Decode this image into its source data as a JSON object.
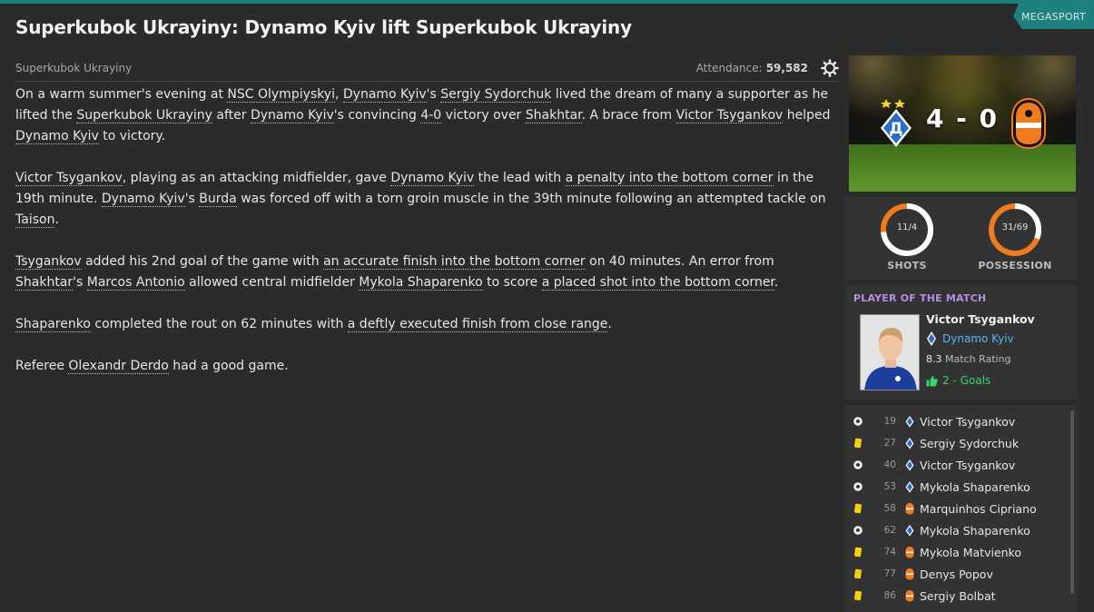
{
  "brand": "MEGASPORT",
  "title": "Superkubok Ukrayiny: Dynamo Kyiv lift Superkubok Ukrayiny",
  "competition": "Superkubok Ukrayiny",
  "attendance_label": "Attendance:",
  "attendance_value": "59,582",
  "article": {
    "p1": [
      {
        "t": "On a warm summer's evening at "
      },
      {
        "t": "NSC Olympiyskyi",
        "link": true
      },
      {
        "t": ", "
      },
      {
        "t": "Dynamo Kyiv",
        "link": true
      },
      {
        "t": "'s "
      },
      {
        "t": "Sergiy Sydorchuk",
        "link": true
      },
      {
        "t": " lived the dream of many a supporter as he lifted the "
      },
      {
        "t": "Superkubok Ukrayiny",
        "link": true
      },
      {
        "t": " after "
      },
      {
        "t": "Dynamo Kyiv",
        "link": true
      },
      {
        "t": "'s convincing "
      },
      {
        "t": "4-0",
        "link": true
      },
      {
        "t": " victory over "
      },
      {
        "t": "Shakhtar",
        "link": true
      },
      {
        "t": ". A brace from "
      },
      {
        "t": "Victor Tsygankov",
        "link": true
      },
      {
        "t": " helped "
      },
      {
        "t": "Dynamo Kyiv",
        "link": true
      },
      {
        "t": " to victory."
      }
    ],
    "p2": [
      {
        "t": "Victor Tsygankov",
        "link": true
      },
      {
        "t": ", playing as an attacking midfielder, gave "
      },
      {
        "t": "Dynamo Kyiv",
        "link": true
      },
      {
        "t": " the lead with "
      },
      {
        "t": "a penalty into the bottom corner",
        "link": true
      },
      {
        "t": " in the 19th minute. "
      },
      {
        "t": "Dynamo Kyiv",
        "link": true
      },
      {
        "t": "'s "
      },
      {
        "t": "Burda",
        "link": true
      },
      {
        "t": " was forced off with a torn groin muscle in the 39th minute following an attempted tackle on "
      },
      {
        "t": "Taison",
        "link": true
      },
      {
        "t": "."
      }
    ],
    "p3": [
      {
        "t": "Tsygankov",
        "link": true
      },
      {
        "t": " added his 2nd goal of the game with "
      },
      {
        "t": "an accurate finish into the bottom corner",
        "link": true
      },
      {
        "t": " on 40 minutes. An error from "
      },
      {
        "t": "Shakhtar",
        "link": true
      },
      {
        "t": "'s "
      },
      {
        "t": "Marcos Antonio",
        "link": true
      },
      {
        "t": " allowed central midfielder "
      },
      {
        "t": "Mykola Shaparenko",
        "link": true
      },
      {
        "t": " to score "
      },
      {
        "t": "a placed shot into the bottom corner",
        "link": true
      },
      {
        "t": "."
      }
    ],
    "p4": [
      {
        "t": "Shaparenko",
        "link": true
      },
      {
        "t": " completed the rout on 62 minutes with "
      },
      {
        "t": "a deftly executed finish from close range",
        "link": true
      },
      {
        "t": "."
      }
    ],
    "p5": [
      {
        "t": "Referee "
      },
      {
        "t": "Olexandr Derdo",
        "link": true
      },
      {
        "t": " had a good game."
      }
    ]
  },
  "match": {
    "score": "4 - 0"
  },
  "stats": {
    "shots": {
      "label": "SHOTS",
      "value": "11/4",
      "home_fraction": 0.733
    },
    "possession": {
      "label": "POSSESSION",
      "value": "31/69",
      "home_fraction": 0.31
    }
  },
  "potm": {
    "header": "PLAYER OF THE MATCH",
    "name": "Victor Tsygankov",
    "club": "Dynamo Kyiv",
    "rating": "8.3",
    "rating_label": "Match Rating",
    "goals": "2 - Goals"
  },
  "events": [
    {
      "type": "goal",
      "minute": "19",
      "team": "home",
      "player": "Victor Tsygankov"
    },
    {
      "type": "yellow",
      "minute": "27",
      "team": "home",
      "player": "Sergiy Sydorchuk"
    },
    {
      "type": "goal",
      "minute": "40",
      "team": "home",
      "player": "Victor Tsygankov"
    },
    {
      "type": "goal",
      "minute": "53",
      "team": "home",
      "player": "Mykola Shaparenko"
    },
    {
      "type": "yellow",
      "minute": "58",
      "team": "away",
      "player": "Marquinhos Cipriano"
    },
    {
      "type": "goal",
      "minute": "62",
      "team": "home",
      "player": "Mykola Shaparenko"
    },
    {
      "type": "yellow",
      "minute": "74",
      "team": "away",
      "player": "Mykola Matvienko"
    },
    {
      "type": "yellow",
      "minute": "77",
      "team": "away",
      "player": "Denys Popov"
    },
    {
      "type": "yellow",
      "minute": "86",
      "team": "away",
      "player": "Sergiy Bolbat"
    }
  ],
  "colors": {
    "accent": "#1f7f7f",
    "ring": "#f07a1e",
    "potm": "#b68ee0",
    "club_link": "#5bb4f0",
    "goals": "#37d46a",
    "yellow_card": "#f2d30f"
  }
}
